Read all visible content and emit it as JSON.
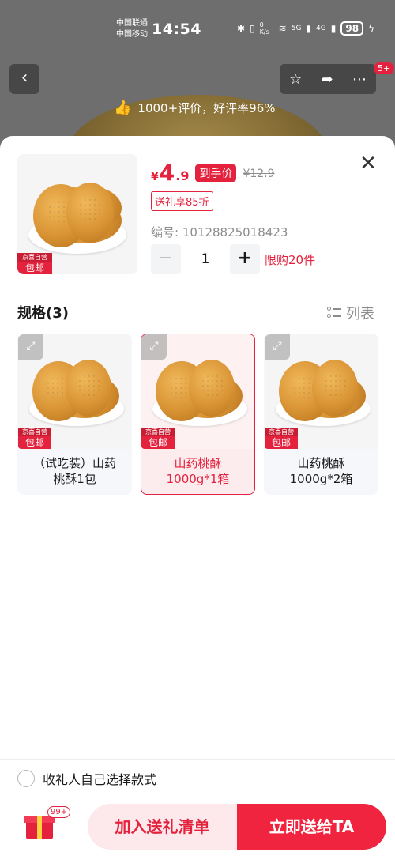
{
  "status_bar": {
    "carrier_1": "中国联通",
    "carrier_2": "中国移动",
    "time": "14:54",
    "net_speed": "0 K/s",
    "net_5g": "5G",
    "net_4g": "4G",
    "battery": "98"
  },
  "nav": {
    "back_icon": "chevron-left-icon",
    "badge": "5+"
  },
  "rating_banner": {
    "text": "1000+评价，好评率96%"
  },
  "product": {
    "currency": "¥",
    "price_int": "4",
    "price_dec": ".9",
    "price_tag": "到手价",
    "original_price": "¥12.9",
    "discount_tag": "送礼享85折",
    "sku_code": "编号: 10128825018423",
    "quantity": "1",
    "limit": "限购20件",
    "badge_top": "京喜自营",
    "badge_bottom": "包邮"
  },
  "spec": {
    "title": "规格(3)",
    "list_toggle": "列表",
    "badge_top": "京喜自营",
    "badge_bottom": "包邮",
    "options": [
      {
        "label": "（试吃装）山药桃酥1包",
        "line1": "（试吃装）山药",
        "line2": "桃酥1包",
        "selected": false
      },
      {
        "label": "山药桃酥1000g*1箱",
        "line1": "山药桃酥",
        "line2": "1000g*1箱",
        "selected": true
      },
      {
        "label": "山药桃酥1000g*2箱",
        "line1": "山药桃酥",
        "line2": "1000g*2箱",
        "selected": false
      }
    ]
  },
  "recipient": {
    "label": "收礼人自己选择款式"
  },
  "actions": {
    "gift_badge": "99+",
    "add_list": "加入送礼清单",
    "send_now": "立即送给TA"
  },
  "colors": {
    "accent": "#e4223d",
    "accent_light": "#fde8eb"
  }
}
